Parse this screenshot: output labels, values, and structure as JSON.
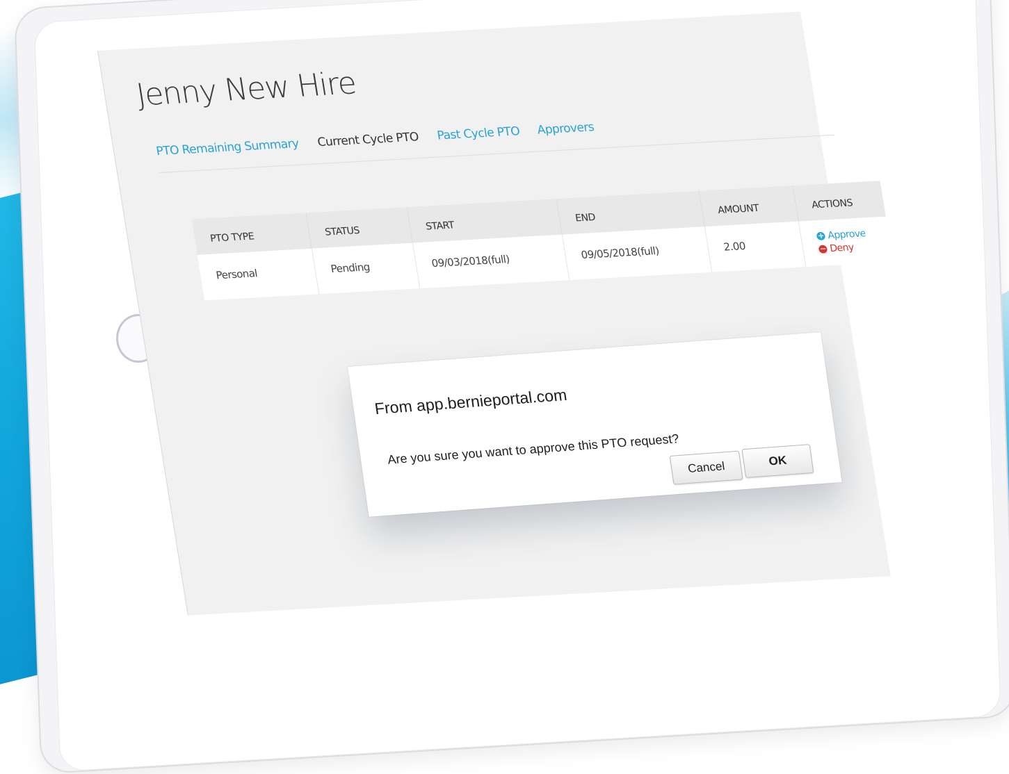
{
  "page": {
    "title": "Jenny New Hire"
  },
  "tabs": [
    {
      "label": "PTO Remaining Summary"
    },
    {
      "label": "Current Cycle PTO"
    },
    {
      "label": "Past Cycle PTO"
    },
    {
      "label": "Approvers"
    }
  ],
  "table": {
    "headers": [
      "PTO TYPE",
      "STATUS",
      "START",
      "END",
      "AMOUNT",
      "ACTIONS"
    ],
    "rows": [
      {
        "pto_type": "Personal",
        "status": "Pending",
        "start": "09/03/2018(full)",
        "end": "09/05/2018(full)",
        "amount": "2.00",
        "approve_label": "Approve",
        "deny_label": "Deny"
      }
    ]
  },
  "dialog": {
    "title": "From app.bernieportal.com",
    "message": "Are you sure you want to approve this PTO request?",
    "cancel_label": "Cancel",
    "ok_label": "OK"
  },
  "icons": {
    "approve": "plus-circle-icon",
    "deny": "minus-circle-icon"
  },
  "colors": {
    "link": "#29a3d4",
    "deny": "#d9342b",
    "brand_blue": "#12a6dc"
  }
}
